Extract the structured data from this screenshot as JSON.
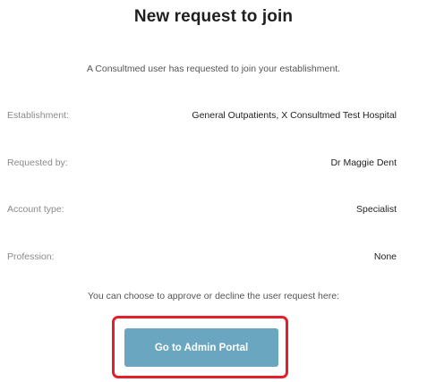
{
  "email": {
    "title": "New request to join",
    "intro": "A Consultmed user has requested to join your establishment.",
    "details": [
      {
        "label": "Establishment:",
        "value": "General Outpatients, X Consultmed Test Hospital"
      },
      {
        "label": "Requested by:",
        "value": "Dr Maggie Dent"
      },
      {
        "label": "Account type:",
        "value": "Specialist"
      },
      {
        "label": "Profession:",
        "value": "None"
      }
    ],
    "footer_text": "You can choose to approve or decline the user request here:",
    "button_label": "Go to Admin Portal"
  },
  "colors": {
    "button_bg": "#6aa6bf",
    "highlight_border": "#e0202a"
  }
}
